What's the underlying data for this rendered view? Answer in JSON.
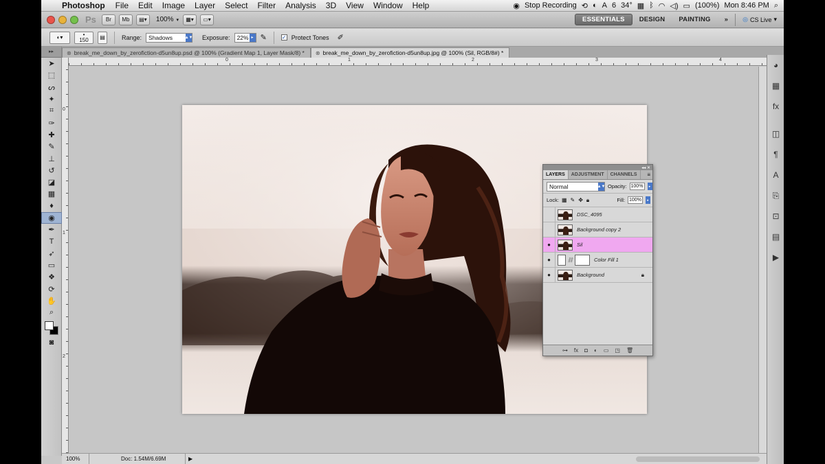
{
  "menubar": {
    "app": "Photoshop",
    "items": [
      "File",
      "Edit",
      "Image",
      "Layer",
      "Select",
      "Filter",
      "Analysis",
      "3D",
      "View",
      "Window",
      "Help"
    ],
    "recording": "Stop Recording",
    "battery": "(100%)",
    "clock": "Mon 8:46 PM",
    "indicator_a": "6",
    "indicator_b": "34°"
  },
  "appbar": {
    "logo": "Ps",
    "zoom": "100%",
    "workspaces": [
      "ESSENTIALS",
      "DESIGN",
      "PAINTING"
    ],
    "active_workspace": "ESSENTIALS",
    "more": "»",
    "cslive": "CS Live"
  },
  "options": {
    "brush_size": "150",
    "range_label": "Range:",
    "range_value": "Shadows",
    "exposure_label": "Exposure:",
    "exposure_value": "22%",
    "protect_label": "Protect Tones",
    "protect_checked": true
  },
  "tabs": [
    {
      "label": "break_me_down_by_zerofiction-d5un8up.psd @ 100% (Gradient Map 1, Layer Mask/8) *",
      "active": false
    },
    {
      "label": "break_me_down_by_zerofiction-d5un8up.jpg @ 100% (Sil, RGB/8#) *",
      "active": true
    }
  ],
  "ruler_top_numbers": [
    "0",
    "1",
    "2",
    "3",
    "4"
  ],
  "ruler_left_numbers": [
    "0",
    "1",
    "2"
  ],
  "status": {
    "zoom": "100%",
    "doc": "Doc: 1.54M/6.69M"
  },
  "layers_panel": {
    "tabs": [
      "LAYERS",
      "ADJUSTMENT",
      "CHANNELS"
    ],
    "blend_mode": "Normal",
    "opacity_label": "Opacity:",
    "opacity_value": "100%",
    "lock_label": "Lock:",
    "fill_label": "Fill:",
    "fill_value": "100%",
    "layers": [
      {
        "name": "DSC_4095",
        "visible": false,
        "selected": false
      },
      {
        "name": "Background copy 2",
        "visible": false,
        "selected": false
      },
      {
        "name": "Sil",
        "visible": true,
        "selected": true
      },
      {
        "name": "Color Fill 1",
        "visible": true,
        "selected": false
      },
      {
        "name": "Background",
        "visible": true,
        "selected": false
      }
    ]
  },
  "colors": {
    "selected_layer": "#f0a8f0",
    "workspace_active": "#6a6a6a",
    "select_arrow": "#4a78c8"
  }
}
